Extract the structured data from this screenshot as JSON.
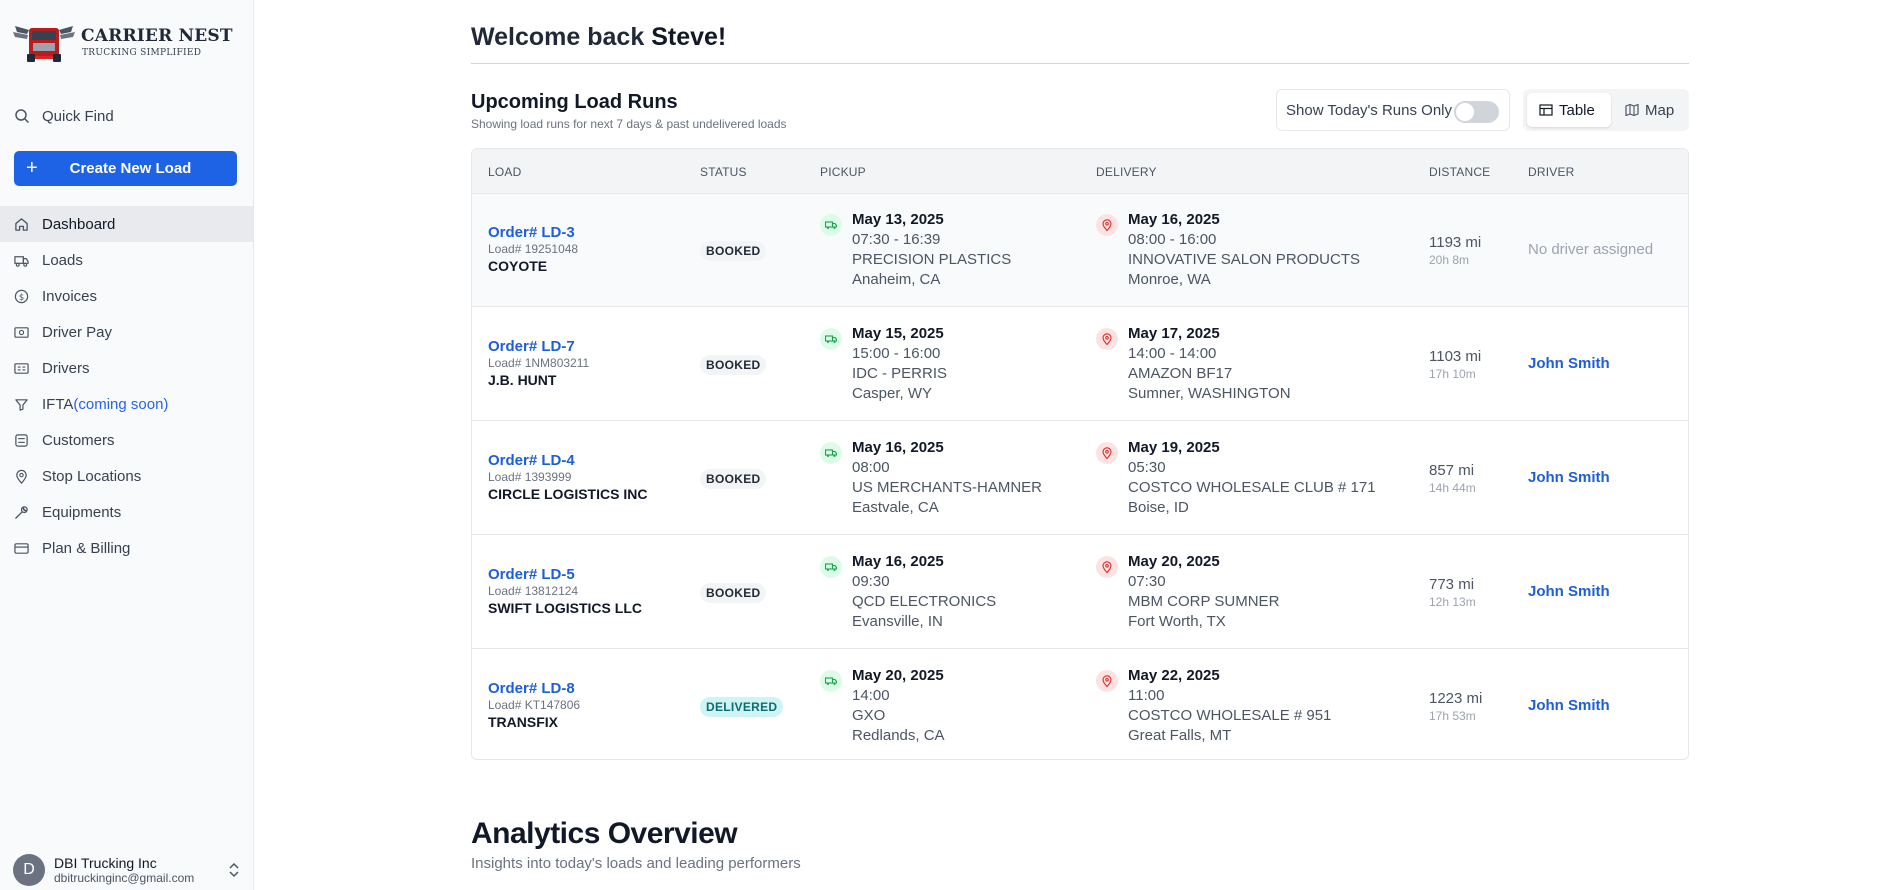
{
  "brand": {
    "name": "CARRIER NEST",
    "tagline": "TRUCKING SIMPLIFIED"
  },
  "sidebar": {
    "quick_find": "Quick Find",
    "create_button": "Create New Load",
    "items": [
      {
        "label": "Dashboard",
        "icon": "home-icon",
        "active": true
      },
      {
        "label": "Loads",
        "icon": "truck-icon"
      },
      {
        "label": "Invoices",
        "icon": "dollar-circle-icon"
      },
      {
        "label": "Driver Pay",
        "icon": "cash-icon"
      },
      {
        "label": "Drivers",
        "icon": "id-card-icon"
      },
      {
        "label": "IFTA",
        "suffix": "(coming soon)",
        "icon": "filter-icon"
      },
      {
        "label": "Customers",
        "icon": "users-icon"
      },
      {
        "label": "Stop Locations",
        "icon": "map-pin-icon"
      },
      {
        "label": "Equipments",
        "icon": "wrench-icon"
      },
      {
        "label": "Plan & Billing",
        "icon": "credit-card-icon"
      }
    ],
    "account": {
      "initial": "D",
      "name": "DBI Trucking Inc",
      "email": "dbitruckinginc@gmail.com"
    }
  },
  "main": {
    "welcome_prefix": "Welcome back",
    "welcome_name": "Steve!",
    "runs_title": "Upcoming Load Runs",
    "runs_subtitle": "Showing load runs for next 7 days & past undelivered loads",
    "toggle_label": "Show Today's Runs Only",
    "view_table": "Table",
    "view_map": "Map",
    "columns": [
      "LOAD",
      "STATUS",
      "PICKUP",
      "DELIVERY",
      "DISTANCE",
      "DRIVER"
    ],
    "rows": [
      {
        "order": "Order# LD-3",
        "load": "Load# 19251048",
        "customer": "COYOTE",
        "status": "BOOKED",
        "pickup": {
          "date": "May 13, 2025",
          "time": "07:30 - 16:39",
          "name": "PRECISION PLASTICS",
          "city": "Anaheim, CA"
        },
        "delivery": {
          "date": "May 16, 2025",
          "time": "08:00 - 16:00",
          "name": "INNOVATIVE SALON PRODUCTS",
          "city": "Monroe, WA"
        },
        "distance": "1193 mi",
        "duration": "20h 8m",
        "driver": "No driver assigned"
      },
      {
        "order": "Order# LD-7",
        "load": "Load# 1NM803211",
        "customer": "J.B. HUNT",
        "status": "BOOKED",
        "pickup": {
          "date": "May 15, 2025",
          "time": "15:00 - 16:00",
          "name": "IDC - PERRIS",
          "city": "Casper, WY"
        },
        "delivery": {
          "date": "May 17, 2025",
          "time": "14:00 - 14:00",
          "name": "AMAZON BF17",
          "city": "Sumner, WASHINGTON"
        },
        "distance": "1103 mi",
        "duration": "17h 10m",
        "driver": "John Smith"
      },
      {
        "order": "Order# LD-4",
        "load": "Load# 1393999",
        "customer": "CIRCLE LOGISTICS INC",
        "status": "BOOKED",
        "pickup": {
          "date": "May 16, 2025",
          "time": "08:00",
          "name": "US MERCHANTS-HAMNER",
          "city": "Eastvale, CA"
        },
        "delivery": {
          "date": "May 19, 2025",
          "time": "05:30",
          "name": "COSTCO WHOLESALE CLUB # 171",
          "city": "Boise, ID"
        },
        "distance": "857 mi",
        "duration": "14h 44m",
        "driver": "John Smith"
      },
      {
        "order": "Order# LD-5",
        "load": "Load# 13812124",
        "customer": "SWIFT LOGISTICS LLC",
        "status": "BOOKED",
        "pickup": {
          "date": "May 16, 2025",
          "time": "09:30",
          "name": "QCD ELECTRONICS",
          "city": "Evansville, IN"
        },
        "delivery": {
          "date": "May 20, 2025",
          "time": "07:30",
          "name": "MBM CORP SUMNER",
          "city": "Fort Worth, TX"
        },
        "distance": "773 mi",
        "duration": "12h 13m",
        "driver": "John Smith"
      },
      {
        "order": "Order# LD-8",
        "load": "Load# KT147806",
        "customer": "TRANSFIX",
        "status": "DELIVERED",
        "pickup": {
          "date": "May 20, 2025",
          "time": "14:00",
          "name": "GXO",
          "city": "Redlands, CA"
        },
        "delivery": {
          "date": "May 22, 2025",
          "time": "11:00",
          "name": "COSTCO WHOLESALE # 951",
          "city": "Great Falls, MT"
        },
        "distance": "1223 mi",
        "duration": "17h 53m",
        "driver": "John Smith"
      }
    ],
    "analytics_title": "Analytics Overview",
    "analytics_subtitle": "Insights into today's loads and leading performers"
  },
  "colors": {
    "accent": "#1e63e6",
    "link": "#1d5fd8",
    "delivered_bg": "#cff4f4",
    "delivered_text": "#0f6b6f"
  }
}
